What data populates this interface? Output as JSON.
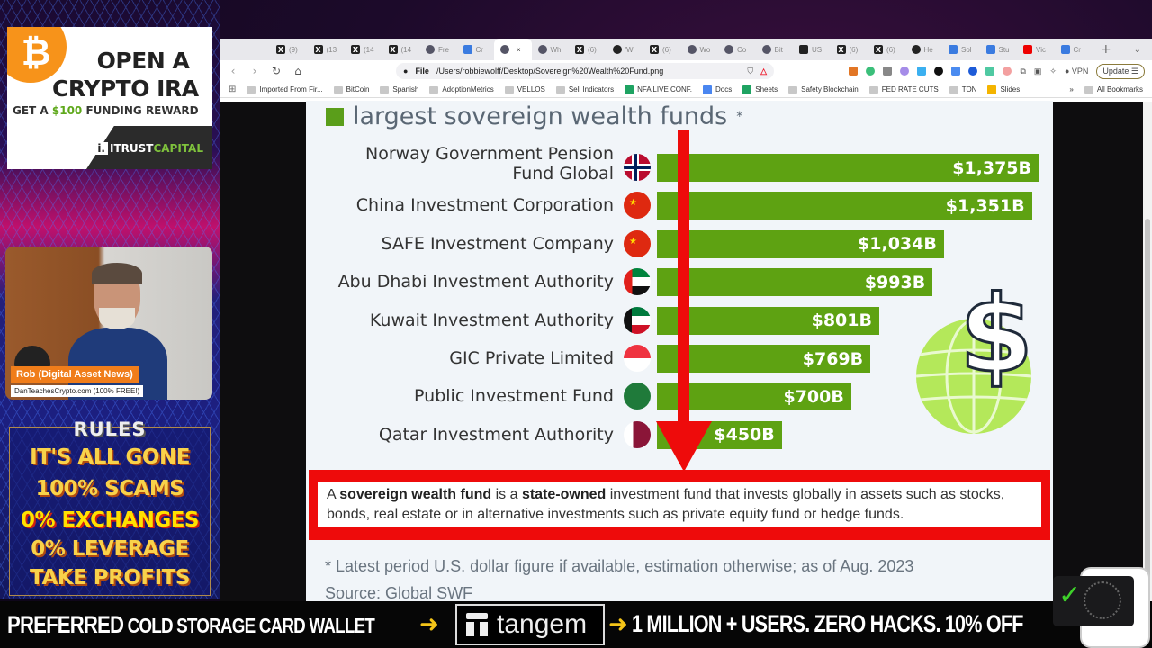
{
  "promo": {
    "icon": "bitcoin-icon",
    "icon_glyph": "₿",
    "line1": "OPEN A",
    "line2": "CRYPTO IRA",
    "subline_prefix": "GET A ",
    "subline_amount": "$100",
    "subline_suffix": " FUNDING REWARD",
    "brand_prefix": "i.",
    "brand_itrust": "ITRUST",
    "brand_capital": "CAPITAL"
  },
  "webcam": {
    "name_tag": "Rob (Digital Asset News)",
    "site_tag": "DanTeachesCrypto.com (100% FREE!)"
  },
  "rules": {
    "title": "RULES",
    "lines": [
      "IT'S ALL GONE",
      "100% SCAMS",
      "0% EXCHANGES",
      "0% LEVERAGE",
      "TAKE PROFITS"
    ]
  },
  "browser": {
    "tabs": [
      {
        "label": "(9)",
        "icon": "x-icon"
      },
      {
        "label": "(13",
        "icon": "x-icon"
      },
      {
        "label": "(14",
        "icon": "x-icon"
      },
      {
        "label": "(14",
        "icon": "x-icon"
      },
      {
        "label": "Fre",
        "icon": "globe-icon"
      },
      {
        "label": "Cr",
        "icon": "app-icon"
      },
      {
        "label": "",
        "icon": "globe-icon",
        "active": true
      },
      {
        "label": "Wh",
        "icon": "globe-icon"
      },
      {
        "label": "(6)",
        "icon": "x-icon"
      },
      {
        "label": "'W",
        "icon": "link-icon"
      },
      {
        "label": "(6)",
        "icon": "x-icon"
      },
      {
        "label": "Wo",
        "icon": "globe-icon"
      },
      {
        "label": "Co",
        "icon": "globe-icon"
      },
      {
        "label": "Bit",
        "icon": "globe-icon"
      },
      {
        "label": "US",
        "icon": "news-icon"
      },
      {
        "label": "(6)",
        "icon": "x-icon"
      },
      {
        "label": "(6)",
        "icon": "x-icon"
      },
      {
        "label": "He",
        "icon": "link-icon"
      },
      {
        "label": "Sol",
        "icon": "app-icon"
      },
      {
        "label": "Stu",
        "icon": "app-icon"
      },
      {
        "label": "Vic",
        "icon": "youtube-icon"
      },
      {
        "label": "Cr",
        "icon": "app-icon"
      }
    ],
    "new_tab": "+",
    "tab_list": "⌄",
    "address": {
      "scheme_label": "File",
      "url": "/Users/robbiewolff/Desktop/Sovereign%20Wealth%20Fund.png"
    },
    "vpn_label": "VPN",
    "update_label": "Update ☰",
    "bookmarks": [
      {
        "label": "Imported From Fir...",
        "type": "folder"
      },
      {
        "label": "BitCoin",
        "type": "folder"
      },
      {
        "label": "Spanish",
        "type": "folder"
      },
      {
        "label": "AdoptionMetrics",
        "type": "folder"
      },
      {
        "label": "VELLOS",
        "type": "folder"
      },
      {
        "label": "Sell Indicators",
        "type": "folder"
      },
      {
        "label": "NFA LIVE CONF.",
        "type": "sheets"
      },
      {
        "label": "Docs",
        "type": "docs"
      },
      {
        "label": "Sheets",
        "type": "sheets"
      },
      {
        "label": "Safety Blockchain",
        "type": "folder"
      },
      {
        "label": "FED RATE CUTS",
        "type": "folder"
      },
      {
        "label": "TON",
        "type": "folder"
      },
      {
        "label": "Slides",
        "type": "slides"
      }
    ],
    "bookmarks_overflow": "»",
    "all_bookmarks": "All Bookmarks"
  },
  "infographic": {
    "title": "largest sovereign wealth funds",
    "title_mark": "*",
    "accent_color": "#5ea212",
    "arrow_color": "#ee0b0b",
    "definition": {
      "pre": "A ",
      "bold1": "sovereign wealth fund",
      "mid": " is a ",
      "bold2": "state-owned",
      "post": " investment fund that invests globally in assets such as stocks, bonds, real estate or in alternative investments such as private equity fund or hedge funds."
    },
    "footnote": "* Latest period U.S. dollar figure if available, estimation otherwise; as of Aug. 2023",
    "source": "Source: Global SWF"
  },
  "chart_data": {
    "type": "bar",
    "orientation": "horizontal",
    "title": "largest sovereign wealth funds*",
    "unit": "USD billions",
    "categories": [
      "Norway Government Pension Fund Global",
      "China Investment Corporation",
      "SAFE Investment Company",
      "Abu Dhabi Investment Authority",
      "Kuwait Investment Authority",
      "GIC Private Limited",
      "Public Investment Fund",
      "Qatar Investment Authority"
    ],
    "labels": [
      "Norway Government Pension|Fund Global",
      "China Investment Corporation",
      "SAFE Investment Company",
      "Abu Dhabi Investment Authority",
      "Kuwait Investment Authority",
      "GIC Private Limited",
      "Public Investment Fund",
      "Qatar Investment Authority"
    ],
    "flags": [
      "norway",
      "china",
      "china",
      "uae",
      "kuwait",
      "singapore",
      "saudi-arabia",
      "qatar"
    ],
    "values": [
      1375,
      1351,
      1034,
      993,
      801,
      769,
      700,
      450
    ],
    "value_labels": [
      "$1,375B",
      "$1,351B",
      "$1,034B",
      "$993B",
      "$801B",
      "$769B",
      "$700B",
      "$450B"
    ],
    "xlim": [
      0,
      1375
    ]
  },
  "ticker": {
    "part1_big": "PREFERRED",
    "part1_small": " COLD STORAGE CARD WALLET",
    "arrow": "➜",
    "brand": "tangem",
    "part2": "1 MILLION + USERS.  ZERO HACKS. 10% OFF"
  }
}
